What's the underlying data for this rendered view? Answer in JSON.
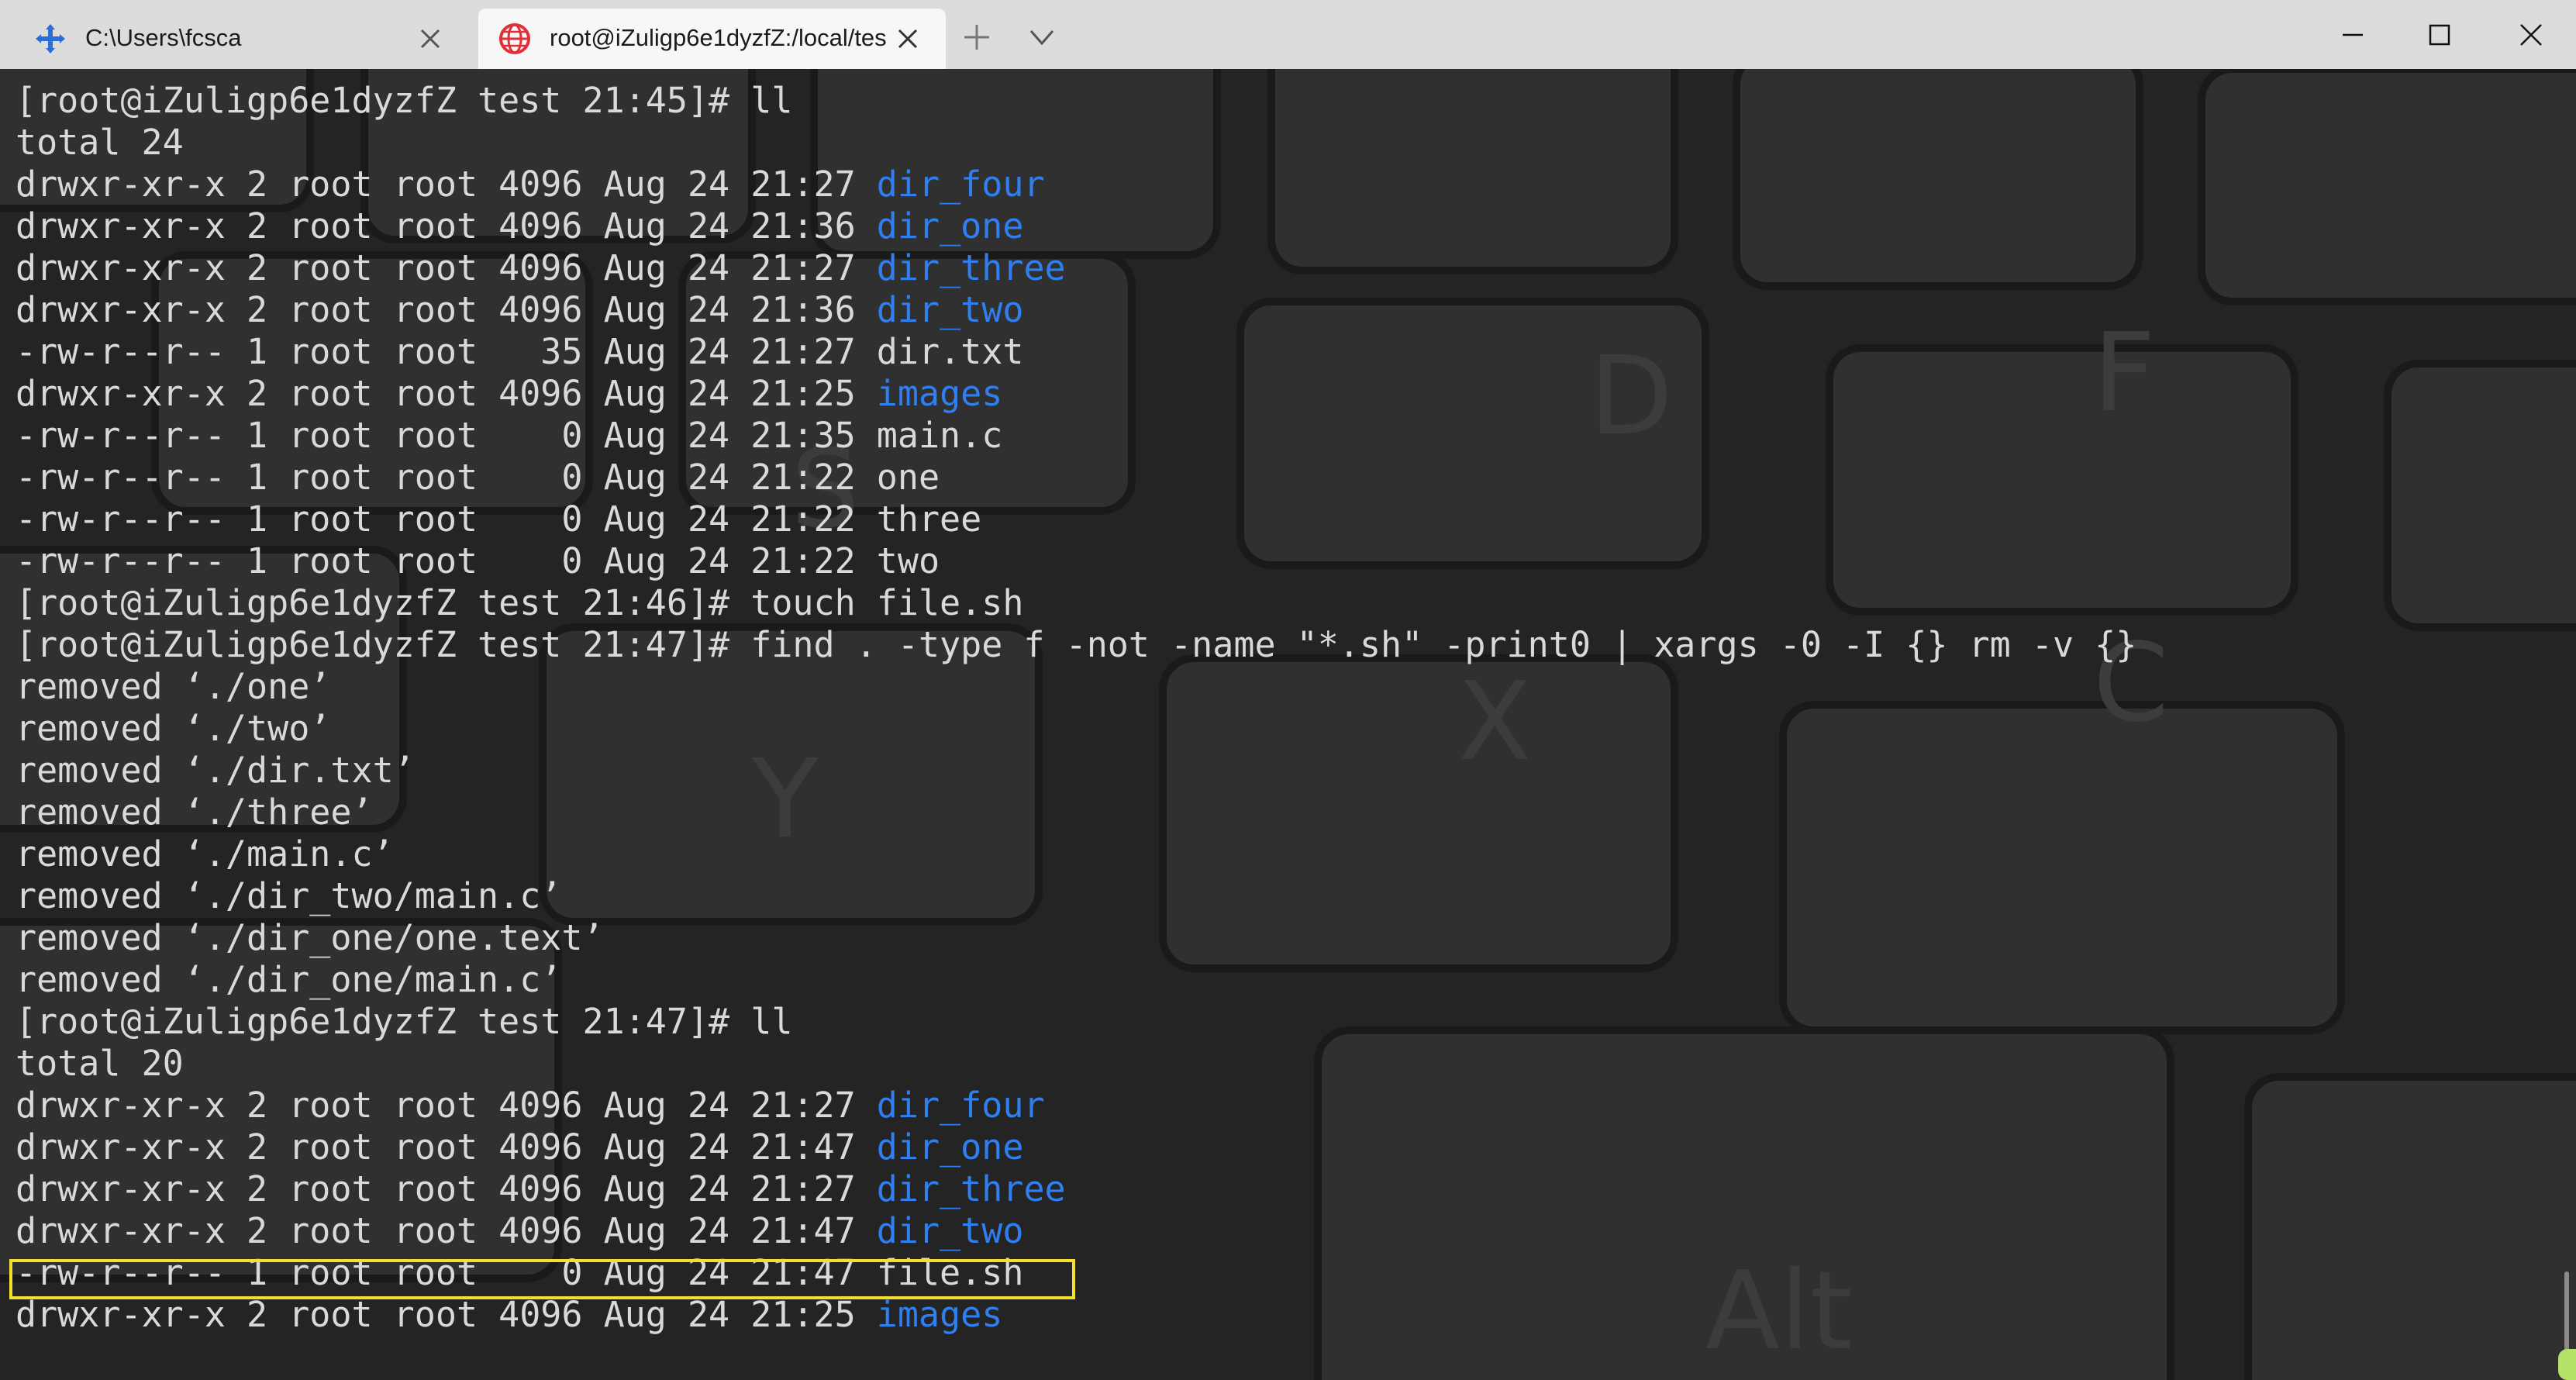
{
  "tabs": [
    {
      "title": "C:\\Users\\fcsca",
      "icon": "arrows-move-icon",
      "active": false
    },
    {
      "title": "root@iZuligp6e1dyzfZ:/local/tes",
      "icon": "globe-icon",
      "active": true
    }
  ],
  "window_controls": [
    "minimize-icon",
    "maximize-icon",
    "close-icon"
  ],
  "terminal": {
    "lines": [
      {
        "plain": "[root@iZuligp6e1dyzfZ test 21:45]# ll",
        "dir": ""
      },
      {
        "plain": "total 24",
        "dir": ""
      },
      {
        "plain": "drwxr-xr-x 2 root root 4096 Aug 24 21:27 ",
        "dir": "dir_four"
      },
      {
        "plain": "drwxr-xr-x 2 root root 4096 Aug 24 21:36 ",
        "dir": "dir_one"
      },
      {
        "plain": "drwxr-xr-x 2 root root 4096 Aug 24 21:27 ",
        "dir": "dir_three"
      },
      {
        "plain": "drwxr-xr-x 2 root root 4096 Aug 24 21:36 ",
        "dir": "dir_two"
      },
      {
        "plain": "-rw-r--r-- 1 root root   35 Aug 24 21:27 dir.txt",
        "dir": ""
      },
      {
        "plain": "drwxr-xr-x 2 root root 4096 Aug 24 21:25 ",
        "dir": "images"
      },
      {
        "plain": "-rw-r--r-- 1 root root    0 Aug 24 21:35 main.c",
        "dir": ""
      },
      {
        "plain": "-rw-r--r-- 1 root root    0 Aug 24 21:22 one",
        "dir": ""
      },
      {
        "plain": "-rw-r--r-- 1 root root    0 Aug 24 21:22 three",
        "dir": ""
      },
      {
        "plain": "-rw-r--r-- 1 root root    0 Aug 24 21:22 two",
        "dir": ""
      },
      {
        "plain": "[root@iZuligp6e1dyzfZ test 21:46]# touch file.sh",
        "dir": ""
      },
      {
        "plain": "[root@iZuligp6e1dyzfZ test 21:47]# find . -type f -not -name \"*.sh\" -print0 | xargs -0 -I {} rm -v {}",
        "dir": ""
      },
      {
        "plain": "removed ‘./one’",
        "dir": ""
      },
      {
        "plain": "removed ‘./two’",
        "dir": ""
      },
      {
        "plain": "removed ‘./dir.txt’",
        "dir": ""
      },
      {
        "plain": "removed ‘./three’",
        "dir": ""
      },
      {
        "plain": "removed ‘./main.c’",
        "dir": ""
      },
      {
        "plain": "removed ‘./dir_two/main.c’",
        "dir": ""
      },
      {
        "plain": "removed ‘./dir_one/one.text’",
        "dir": ""
      },
      {
        "plain": "removed ‘./dir_one/main.c’",
        "dir": ""
      },
      {
        "plain": "[root@iZuligp6e1dyzfZ test 21:47]# ll",
        "dir": ""
      },
      {
        "plain": "total 20",
        "dir": ""
      },
      {
        "plain": "drwxr-xr-x 2 root root 4096 Aug 24 21:27 ",
        "dir": "dir_four"
      },
      {
        "plain": "drwxr-xr-x 2 root root 4096 Aug 24 21:47 ",
        "dir": "dir_one"
      },
      {
        "plain": "drwxr-xr-x 2 root root 4096 Aug 24 21:27 ",
        "dir": "dir_three"
      },
      {
        "plain": "drwxr-xr-x 2 root root 4096 Aug 24 21:47 ",
        "dir": "dir_two"
      },
      {
        "plain": "-rw-r--r-- 1 root root    0 Aug 24 21:47 file.sh",
        "dir": ""
      },
      {
        "plain": "drwxr-xr-x 2 root root 4096 Aug 24 21:25 ",
        "dir": "images"
      }
    ]
  },
  "colors": {
    "directory": "#2f7ff0",
    "text": "#d9d9d9",
    "highlight": "#f2e12a"
  }
}
